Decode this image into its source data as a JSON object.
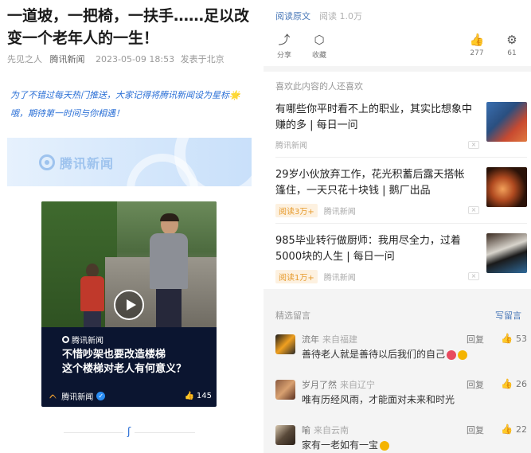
{
  "article": {
    "title": "一道坡，一把椅，一扶手……足以改变一个老年人的一生！",
    "prefix": "先见之人",
    "source": "腾讯新闻",
    "time": "2023-05-09 18:53",
    "location": "发表于北京",
    "promo_text": "为了不错过每天热门推送，大家记得将腾讯新闻设为星标🌟哦，期待第一时间与你相遇！",
    "banner_logo": "腾讯新闻"
  },
  "video": {
    "tag": "腾讯新闻",
    "headline_line1": "不惜吵架也要改造楼梯",
    "headline_line2": "这个楼梯对老人有何意义？",
    "channel": "腾讯新闻",
    "likes": "145"
  },
  "top": {
    "read_original": "阅读原文",
    "read_count": "阅读 1.0万"
  },
  "actions": {
    "share": "分享",
    "favorite": "收藏",
    "like_count": "277",
    "gear_count": "61"
  },
  "recommend": {
    "heading": "喜欢此内容的人还喜欢",
    "items": [
      {
        "title": "有哪些你平时看不上的职业，其实比想象中赚的多 | 每日一问",
        "badge": "",
        "source": "腾讯新闻"
      },
      {
        "title": "29岁小伙放弃工作，花光积蓄后露天搭帐篷住，一天只花十块钱 | 鹅厂出品",
        "badge": "阅读3万+",
        "source": "腾讯新闻"
      },
      {
        "title": "985毕业转行做厨师：我用尽全力，过着5000块的人生 | 每日一问",
        "badge": "阅读1万+",
        "source": "腾讯新闻"
      }
    ]
  },
  "comments": {
    "heading": "精选留言",
    "write": "写留言",
    "reply_label": "回复",
    "items": [
      {
        "user": "流年",
        "from": "来自福建",
        "text": "善待老人就是善待以后我们的自己",
        "likes": "53"
      },
      {
        "user": "岁月了然",
        "from": "来自辽宁",
        "text": "唯有历经风雨，才能面对未来和时光",
        "likes": "26"
      },
      {
        "user": "喻",
        "from": "来自云南",
        "text": "家有一老如有一宝",
        "likes": "22"
      }
    ]
  },
  "colors": {
    "link_blue": "#4a78b8",
    "promo_blue": "#2a6fd6",
    "badge_orange": "#e69a2c"
  }
}
